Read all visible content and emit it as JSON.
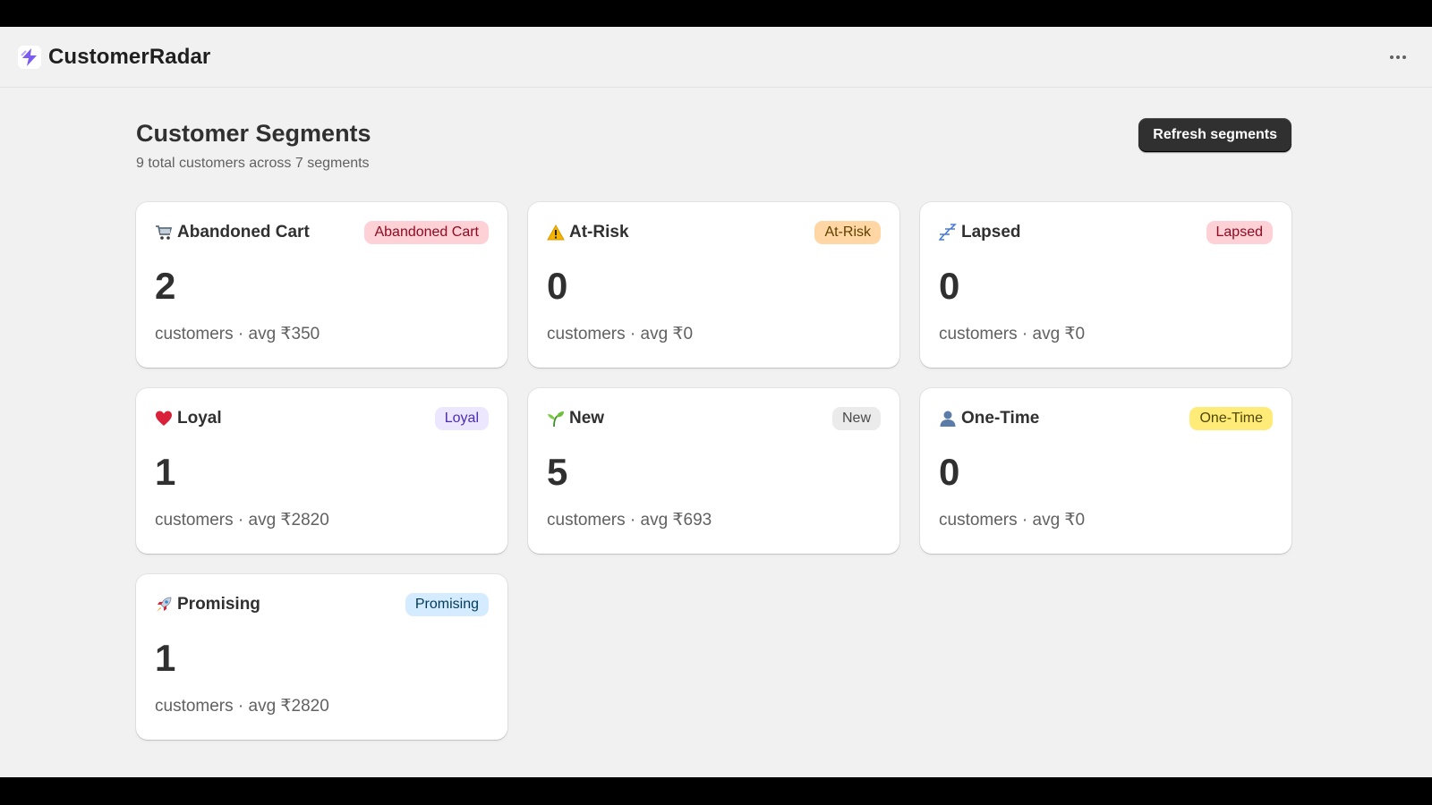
{
  "app": {
    "name": "CustomerRadar",
    "accent_color": "#7b5cf0"
  },
  "header": {
    "title": "Customer Segments",
    "subtitle": "9 total customers across 7 segments",
    "refresh_label": "Refresh segments"
  },
  "segments": [
    {
      "title": "Abandoned Cart",
      "badge": "Abandoned Cart",
      "count": "2",
      "meta": "customers · avg ₹350",
      "icon": "cart-icon",
      "badge_bg": "#fed1d7",
      "badge_fg": "#8e0b21"
    },
    {
      "title": "At-Risk",
      "badge": "At-Risk",
      "count": "0",
      "meta": "customers · avg ₹0",
      "icon": "warning-icon",
      "badge_bg": "#ffd6a4",
      "badge_fg": "#5e4200"
    },
    {
      "title": "Lapsed",
      "badge": "Lapsed",
      "count": "0",
      "meta": "customers · avg ₹0",
      "icon": "sleep-icon",
      "badge_bg": "#fed1d7",
      "badge_fg": "#8e0b21"
    },
    {
      "title": "Loyal",
      "badge": "Loyal",
      "count": "1",
      "meta": "customers · avg ₹2820",
      "icon": "heart-icon",
      "badge_bg": "#ece6ff",
      "badge_fg": "#4c2db3"
    },
    {
      "title": "New",
      "badge": "New",
      "count": "5",
      "meta": "customers · avg ₹693",
      "icon": "seedling-icon",
      "badge_bg": "#ebebeb",
      "badge_fg": "#4a4a4a"
    },
    {
      "title": "One-Time",
      "badge": "One-Time",
      "count": "0",
      "meta": "customers · avg ₹0",
      "icon": "person-icon",
      "badge_bg": "#ffeb78",
      "badge_fg": "#4f4700"
    },
    {
      "title": "Promising",
      "badge": "Promising",
      "count": "1",
      "meta": "customers · avg ₹2820",
      "icon": "rocket-icon",
      "badge_bg": "#d5ebff",
      "badge_fg": "#003a5a"
    }
  ]
}
